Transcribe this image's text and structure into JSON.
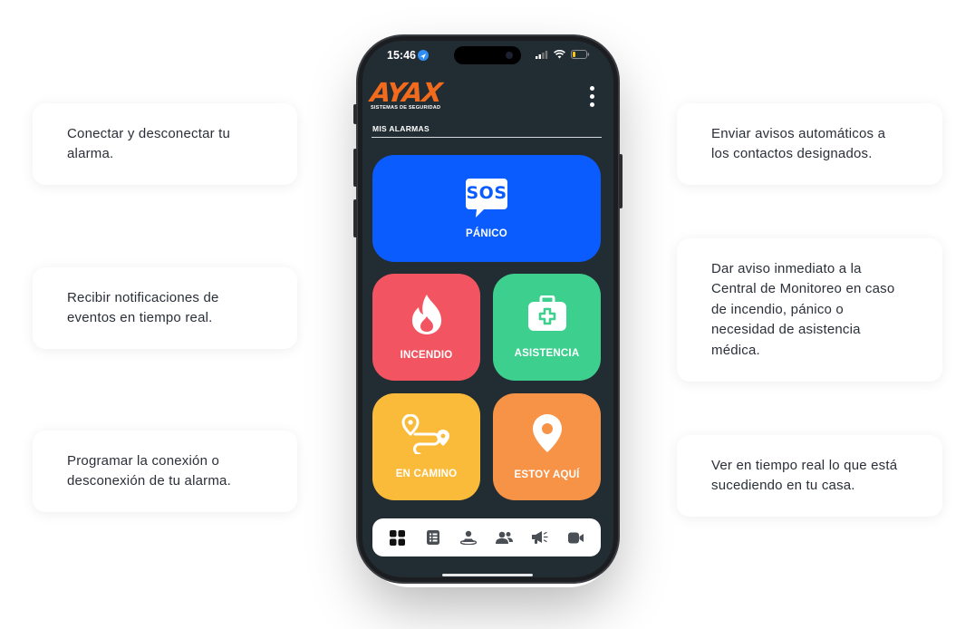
{
  "features": {
    "left": [
      "Conectar y desconectar tu\nalarma.",
      "Recibir notificaciones de\neventos en tiempo real.",
      "Programar la conexión o\ndesconexión de tu alarma."
    ],
    "right": [
      "Enviar avisos automáticos a\nlos contactos designados.",
      "Dar aviso inmediato a la\nCentral de Monitoreo en caso\nde incendio, pánico o\nnecesidad de asistencia\nmédica.",
      "Ver en tiempo real lo que está\nsucediendo en tu casa."
    ]
  },
  "status_bar": {
    "time": "15:46",
    "icons": [
      "location-arrow-icon",
      "signal-icon",
      "wifi-icon",
      "battery-low-icon"
    ]
  },
  "app": {
    "brand": "AYAX",
    "brand_sub": "SISTEMAS DE SEGURIDAD",
    "brand_color": "#f26b1d",
    "section_title": "MIS ALARMAS",
    "tiles": {
      "panic": {
        "label": "PÁNICO",
        "badge": "SOS",
        "color": "#0a5cff"
      },
      "fire": {
        "label": "INCENDIO",
        "color": "#f25561"
      },
      "assist": {
        "label": "ASISTENCIA",
        "color": "#3dcf8e"
      },
      "onway": {
        "label": "EN CAMINO",
        "color": "#fbbb3a"
      },
      "here": {
        "label": "ESTOY AQUÍ",
        "color": "#f69347"
      }
    },
    "tabs": [
      "grid-icon",
      "list-icon",
      "user-zone-icon",
      "contacts-icon",
      "megaphone-icon",
      "video-camera-icon"
    ]
  }
}
